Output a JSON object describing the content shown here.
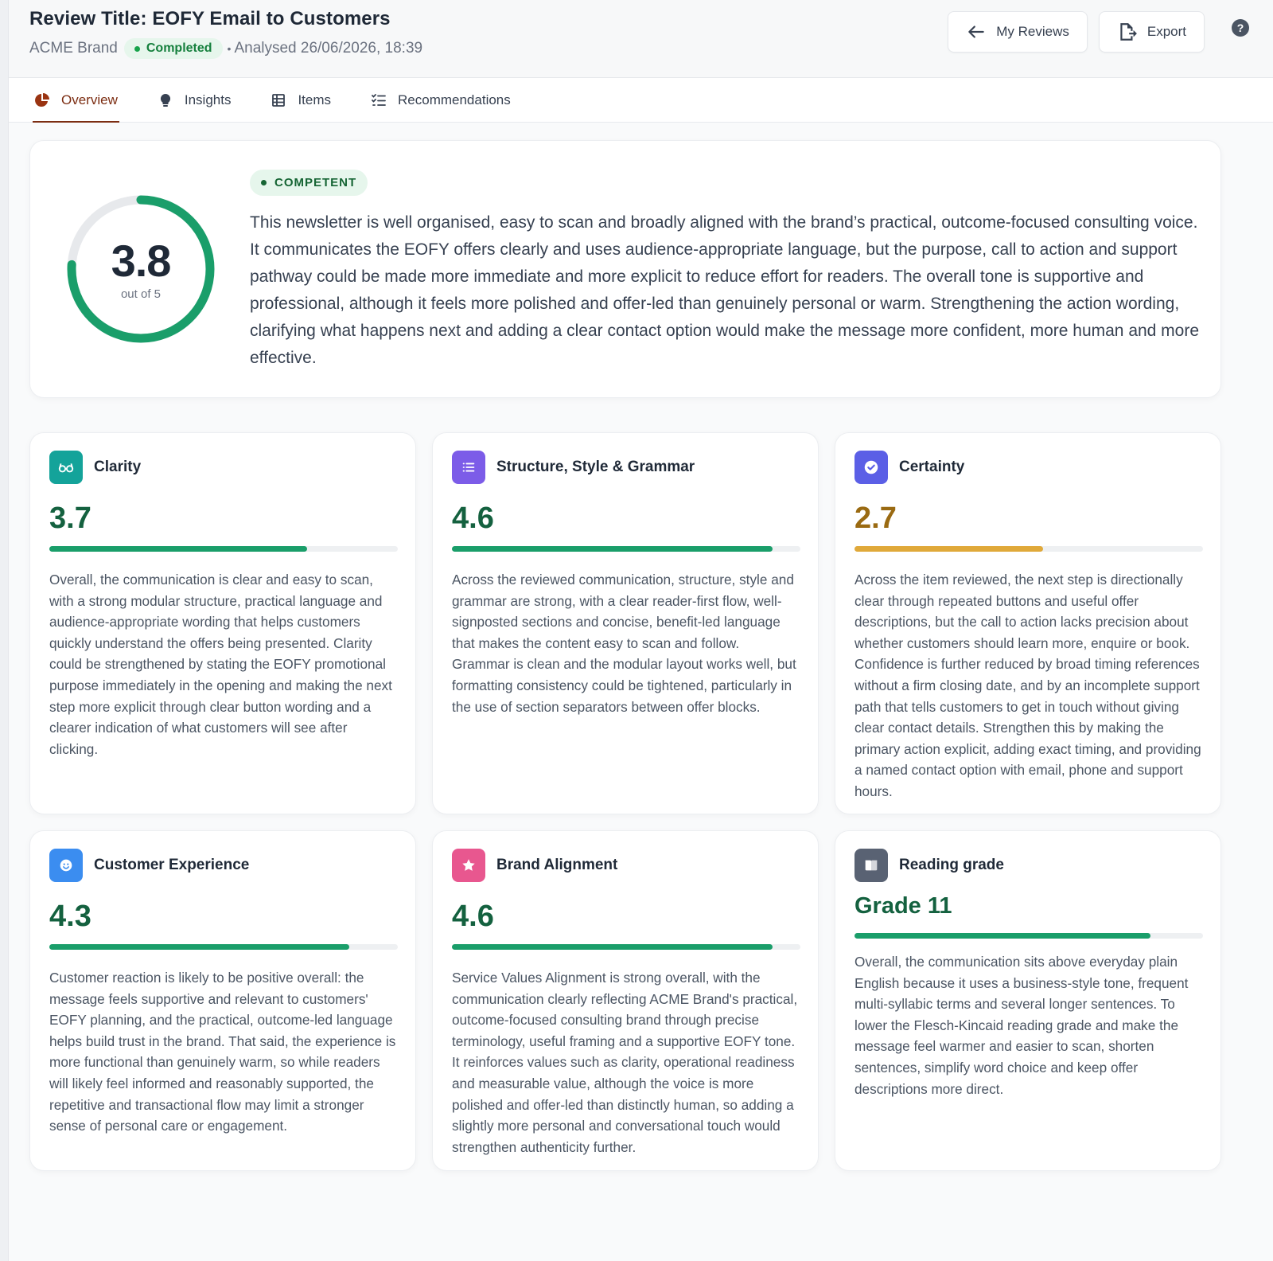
{
  "header": {
    "title": "Review Title: EOFY Email to Customers",
    "brand": "ACME Brand",
    "status": "Completed",
    "analysed": "Analysed 26/06/2026, 18:39",
    "my_reviews_label": "My Reviews",
    "export_label": "Export",
    "help_glyph": "?"
  },
  "tabs": [
    {
      "label": "Overview",
      "icon": "pie-chart-icon",
      "active": true
    },
    {
      "label": "Insights",
      "icon": "lightbulb-icon",
      "active": false
    },
    {
      "label": "Items",
      "icon": "table-icon",
      "active": false
    },
    {
      "label": "Recommendations",
      "icon": "checklist-icon",
      "active": false
    }
  ],
  "summary": {
    "score": "3.8",
    "score_value": 3.8,
    "score_max": 5,
    "score_sub": "out of 5",
    "rating": "COMPETENT",
    "text": "This newsletter is well organised, easy to scan and broadly aligned with the brand’s practical, outcome-focused consulting voice. It communicates the EOFY offers clearly and uses audience-appropriate language, but the purpose, call to action and support pathway could be made more immediate and more explicit to reduce effort for readers. The overall tone is supportive and professional, although it feels more polished and offer-led than genuinely personal or warm. Strengthening the action wording, clarifying what happens next and adding a clear contact option would make the message more confident, more human and more effective."
  },
  "colors": {
    "green": "#1a9e6a",
    "green_text": "#14613f",
    "amber": "#e0a93a",
    "amber_text": "#9a6a12",
    "teal": "#14a39a",
    "purple": "#7c5ce8",
    "indigo": "#5b5fe6",
    "blue": "#3b8df0",
    "pink": "#e8578f",
    "slate": "#596273"
  },
  "cards": [
    {
      "title": "Clarity",
      "icon": "glasses-icon",
      "score": "3.7",
      "fill": 0.74,
      "text": "Overall, the communication is clear and easy to scan, with a strong modular structure, practical language and audience-appropriate wording that helps customers quickly understand the offers being presented. Clarity could be strengthened by stating the EOFY promotional purpose immediately in the opening and making the next step more explicit through clear button wording and a clearer indication of what customers will see after clicking."
    },
    {
      "title": "Structure, Style & Grammar",
      "icon": "list-icon",
      "score": "4.6",
      "fill": 0.92,
      "text": "Across the reviewed communication, structure, style and grammar are strong, with a clear reader-first flow, well-signposted sections and concise, benefit-led language that makes the content easy to scan and follow. Grammar is clean and the modular layout works well, but formatting consistency could be tightened, particularly in the use of section separators between offer blocks."
    },
    {
      "title": "Certainty",
      "icon": "check-badge-icon",
      "score": "2.7",
      "fill": 0.54,
      "text": "Across the item reviewed, the next step is directionally clear through repeated buttons and useful offer descriptions, but the call to action lacks precision about whether customers should learn more, enquire or book. Confidence is further reduced by broad timing references without a firm closing date, and by an incomplete support path that tells customers to get in touch without giving clear contact details. Strengthen this by making the primary action explicit, adding exact timing, and providing a named contact option with email, phone and support hours."
    },
    {
      "title": "Customer Experience",
      "icon": "smile-icon",
      "score": "4.3",
      "fill": 0.86,
      "text": "Customer reaction is likely to be positive overall: the message feels supportive and relevant to customers' EOFY planning, and the practical, outcome-led language helps build trust in the brand. That said, the experience is more functional than genuinely warm, so while readers will likely feel informed and reasonably supported, the repetitive and transactional flow may limit a stronger sense of personal care or engagement."
    },
    {
      "title": "Brand Alignment",
      "icon": "star-icon",
      "score": "4.6",
      "fill": 0.92,
      "text": "Service Values Alignment is strong overall, with the communication clearly reflecting ACME Brand's practical, outcome-focused consulting brand through precise terminology, useful framing and a supportive EOFY tone. It reinforces values such as clarity, operational readiness and measurable value, although the voice is more polished and offer-led than distinctly human, so adding a slightly more personal and conversational touch would strengthen authenticity further."
    },
    {
      "title": "Reading grade",
      "icon": "book-icon",
      "score": "Grade 11",
      "fill": 0.85,
      "text": "Overall, the communication sits above everyday plain English because it uses a business-style tone, frequent multi-syllabic terms and several longer sentences. To lower the Flesch-Kincaid reading grade and make the message feel warmer and easier to scan, shorten sentences, simplify word choice and keep offer descriptions more direct."
    }
  ]
}
